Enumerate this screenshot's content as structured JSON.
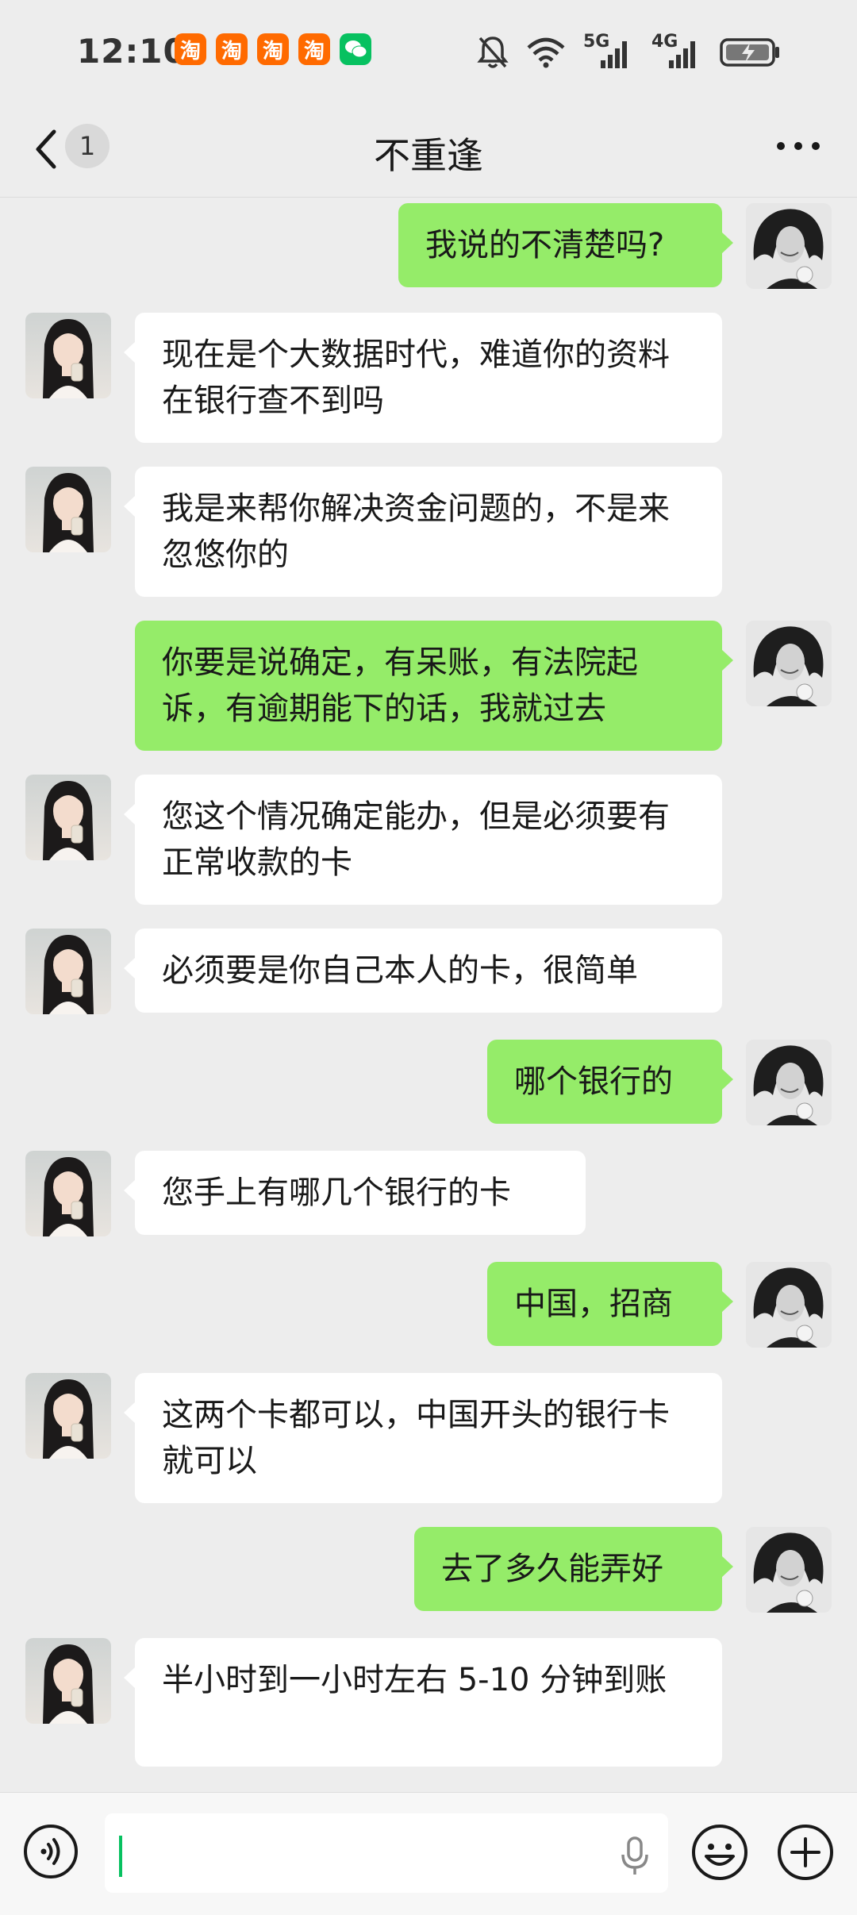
{
  "status_bar": {
    "time": "12:10",
    "app_icons": [
      {
        "name": "taobao-icon",
        "glyph": "淘",
        "color": "#ff6a00"
      },
      {
        "name": "taobao-icon",
        "glyph": "淘",
        "color": "#ff6a00"
      },
      {
        "name": "taobao-icon",
        "glyph": "淘",
        "color": "#ff6a00"
      },
      {
        "name": "taobao-icon",
        "glyph": "淘",
        "color": "#ff6a00"
      },
      {
        "name": "wechat-icon",
        "glyph": "",
        "color": "#07c160"
      }
    ],
    "network_5g": "5G",
    "network_4g": "4G"
  },
  "header": {
    "unread_count": "1",
    "title": "不重逢"
  },
  "messages": [
    {
      "dir": "out",
      "text": "我说的不清楚吗?"
    },
    {
      "dir": "in",
      "text": "现在是个大数据时代，难道你的资料在银行查不到吗"
    },
    {
      "dir": "in",
      "text": "我是来帮你解决资金问题的，不是来忽悠你的"
    },
    {
      "dir": "out",
      "text": "你要是说确定，有呆账，有法院起诉，有逾期能下的话，我就过去"
    },
    {
      "dir": "in",
      "text": "您这个情况确定能办，但是必须要有正常收款的卡"
    },
    {
      "dir": "in",
      "text": "必须要是你自己本人的卡，很简单"
    },
    {
      "dir": "out",
      "text": "哪个银行的"
    },
    {
      "dir": "in",
      "text": "您手上有哪几个银行的卡"
    },
    {
      "dir": "out",
      "text": "中国，招商"
    },
    {
      "dir": "in",
      "text": "这两个卡都可以，中国开头的银行卡就可以"
    },
    {
      "dir": "out",
      "text": "去了多久能弄好"
    },
    {
      "dir": "in",
      "text": "半小时到一小时左右 5-10 分钟到账"
    }
  ],
  "colors": {
    "outgoing_bubble": "#95ec69",
    "incoming_bubble": "#ffffff",
    "background": "#ededed",
    "accent": "#07c160"
  },
  "input_bar": {
    "text": ""
  }
}
